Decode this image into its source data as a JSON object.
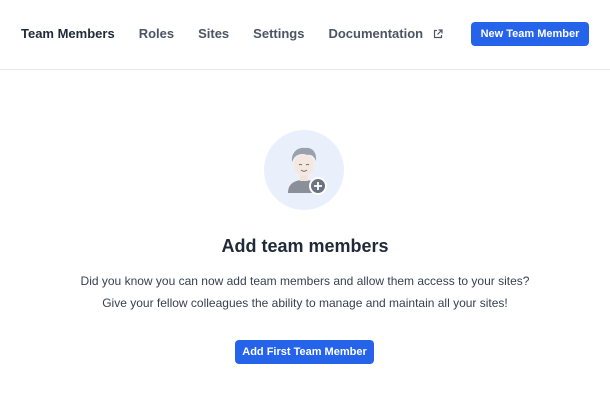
{
  "nav": {
    "items": [
      {
        "label": "Team Members",
        "active": true
      },
      {
        "label": "Roles",
        "active": false
      },
      {
        "label": "Sites",
        "active": false
      },
      {
        "label": "Settings",
        "active": false
      },
      {
        "label": "Documentation",
        "active": false,
        "icon": "external-link-icon"
      }
    ],
    "new_button_label": "New Team Member"
  },
  "empty_state": {
    "icon": "add-user-icon",
    "title": "Add team members",
    "line1": "Did you know you can now add team members and allow them access to your sites?",
    "line2": "Give your fellow colleagues the ability to manage and maintain all your sites!",
    "button_label": "Add First Team Member"
  },
  "colors": {
    "accent": "#2563eb",
    "illustration_bg": "#eaf0fb"
  }
}
